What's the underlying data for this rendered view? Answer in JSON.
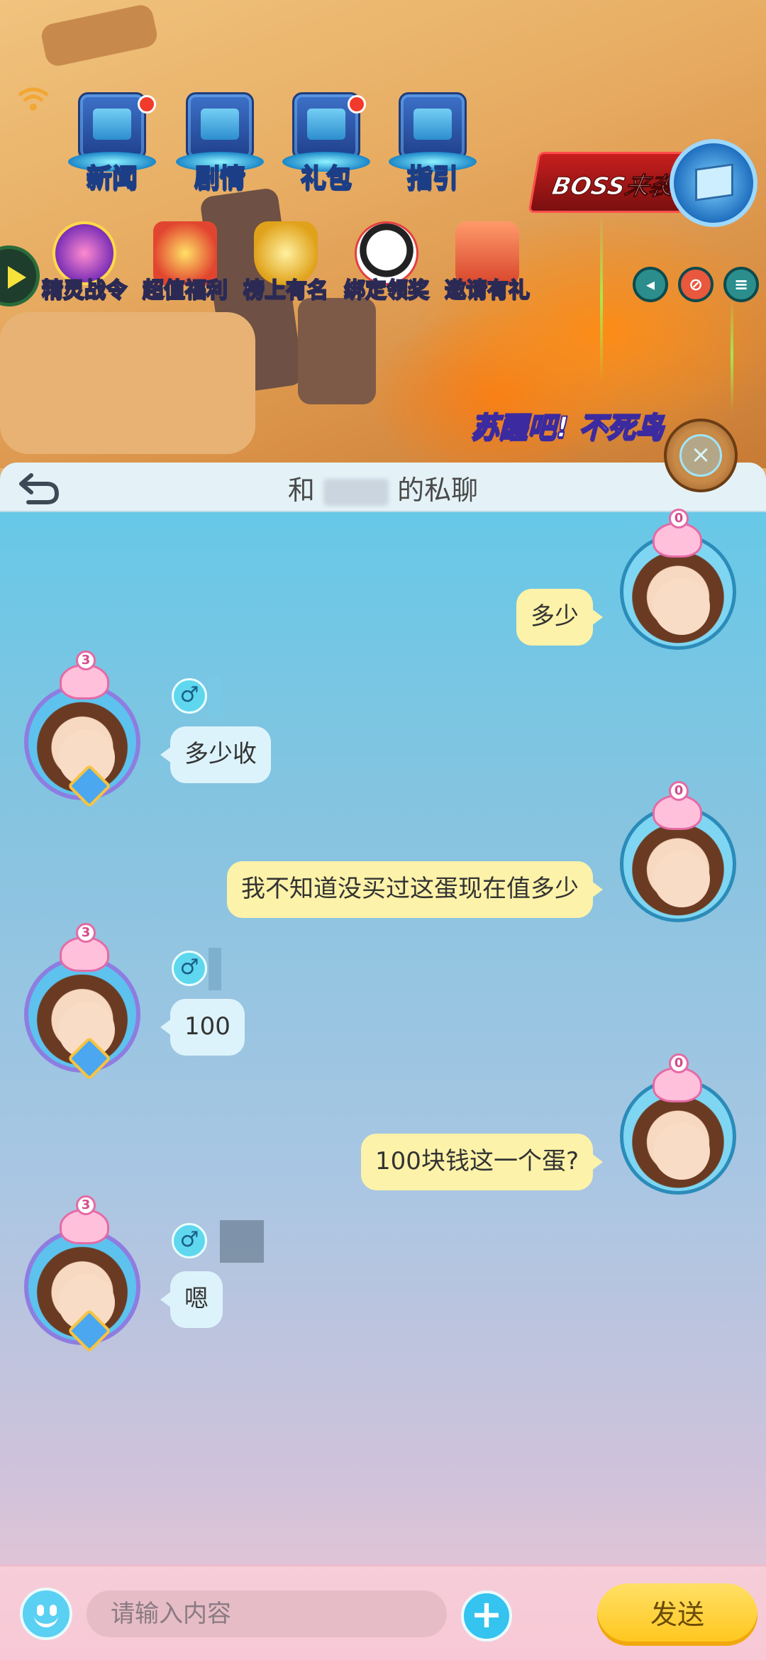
{
  "scene": {
    "top_icons": [
      {
        "label": "新闻",
        "icon": "newspaper-tv-icon",
        "badge": true
      },
      {
        "label": "剧情",
        "icon": "story-chest-icon",
        "badge": false
      },
      {
        "label": "礼包",
        "icon": "gift-locker-icon",
        "badge": true
      },
      {
        "label": "指引",
        "icon": "guide-chest-icon",
        "badge": false
      }
    ],
    "activity_icons": [
      {
        "label": "精灵战令",
        "icon": "battle-pass-icon"
      },
      {
        "label": "超值福利",
        "icon": "gift-box-icon"
      },
      {
        "label": "榜上有名",
        "icon": "trophy-icon"
      },
      {
        "label": "绑定领奖",
        "icon": "panda-icon"
      },
      {
        "label": "邀请有礼",
        "icon": "invite-gift-icon"
      }
    ],
    "boss_banner": "BOSS来袭",
    "event_banner": "苏醒吧! 不死鸟"
  },
  "chat": {
    "header": {
      "prefix": "和",
      "suffix": "的私聊"
    },
    "messages": [
      {
        "from": "me",
        "text": "多少",
        "level": "0"
      },
      {
        "from": "other",
        "text": "多少收",
        "level": "3"
      },
      {
        "from": "me",
        "text": "我不知道没买过这蛋现在值多少",
        "level": "0"
      },
      {
        "from": "other",
        "text": "100",
        "level": "3"
      },
      {
        "from": "me",
        "text": "100块钱这一个蛋?",
        "level": "0"
      },
      {
        "from": "other",
        "text": "嗯",
        "level": "3"
      }
    ]
  },
  "input": {
    "placeholder": "请输入内容",
    "send_label": "发送"
  },
  "colors": {
    "chat_bg_top": "#62c9e8",
    "chat_bg_bottom": "#f1c7d3",
    "my_bubble": "#fdf2a9",
    "other_bubble": "#ddf3fb",
    "send_button": "#ffc61a"
  }
}
